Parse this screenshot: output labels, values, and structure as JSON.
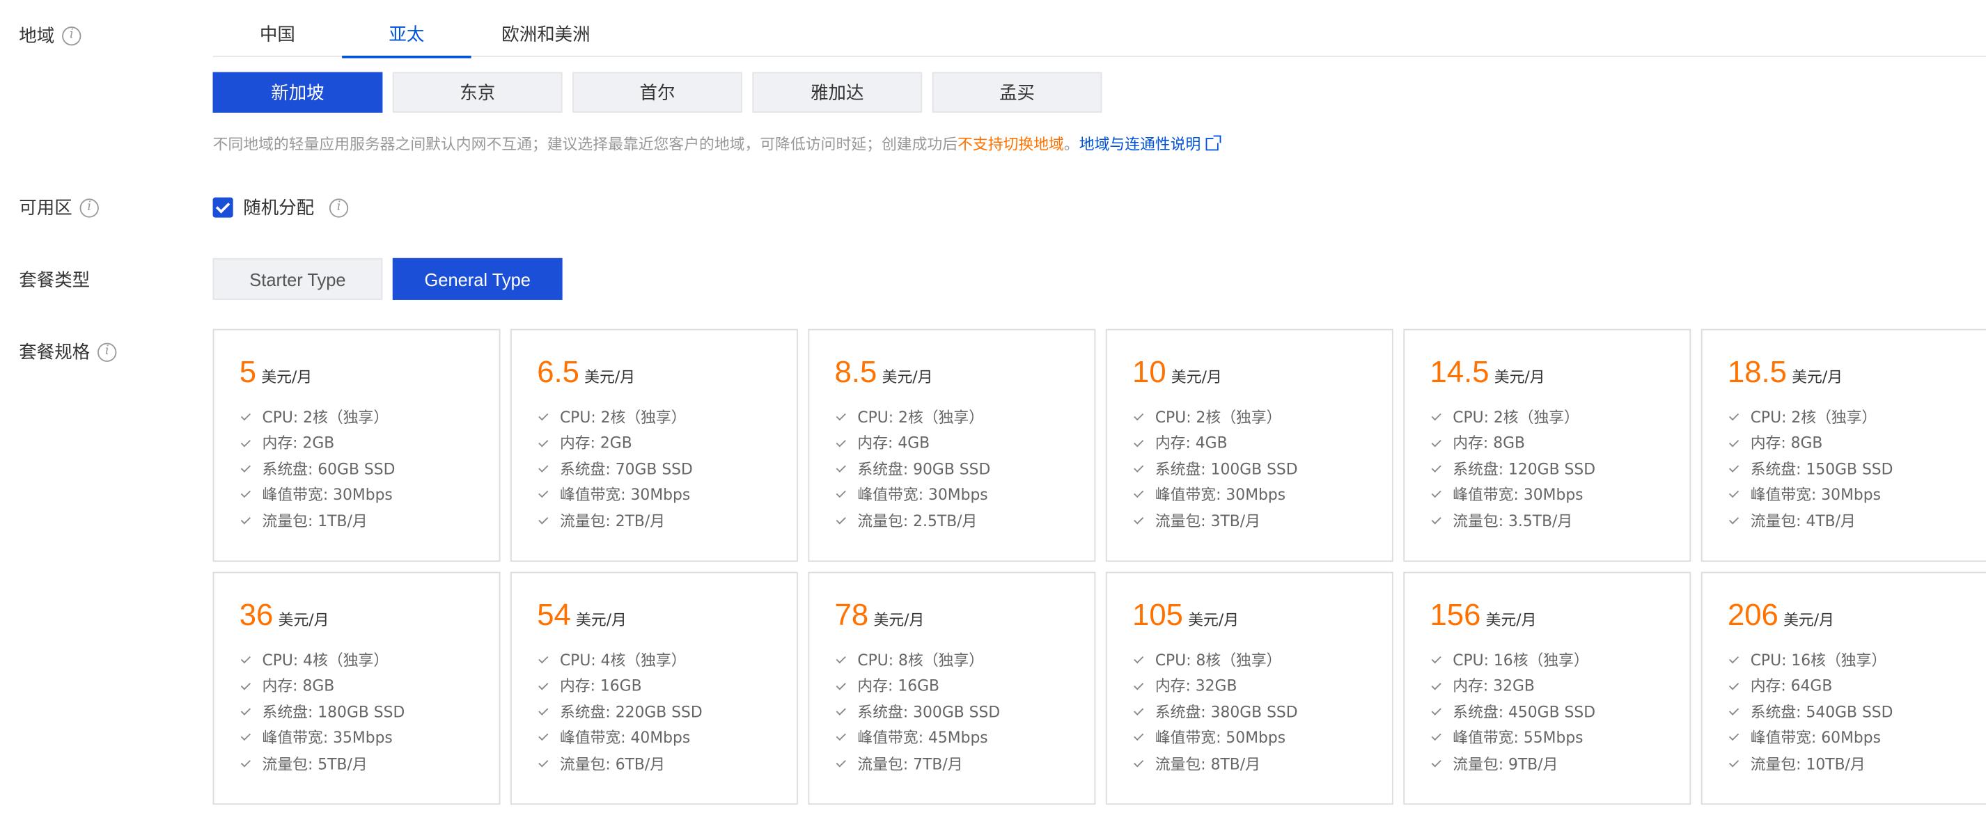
{
  "labels": {
    "region": "地域",
    "zone": "可用区",
    "package_type": "套餐类型",
    "package_spec": "套餐规格"
  },
  "region_tabs": [
    {
      "label": "中国",
      "active": false
    },
    {
      "label": "亚太",
      "active": true
    },
    {
      "label": "欧洲和美洲",
      "active": false
    }
  ],
  "cities": [
    {
      "label": "新加坡",
      "active": true
    },
    {
      "label": "东京",
      "active": false
    },
    {
      "label": "首尔",
      "active": false
    },
    {
      "label": "雅加达",
      "active": false
    },
    {
      "label": "孟买",
      "active": false
    }
  ],
  "notice": {
    "text": "不同地域的轻量应用服务器之间默认内网不互通；建议选择最靠近您客户的地域，可降低访问时延；创建成功后",
    "warning": "不支持切换地域",
    "link": "地域与连通性说明"
  },
  "zone": {
    "checkbox_label": "随机分配",
    "checked": true
  },
  "package_types": [
    {
      "label": "Starter Type",
      "active": false
    },
    {
      "label": "General Type",
      "active": true
    }
  ],
  "plans": [
    [
      {
        "price": "5",
        "unit": "美元/月",
        "specs": [
          "CPU: 2核（独享）",
          "内存: 2GB",
          "系统盘: 60GB SSD",
          "峰值带宽: 30Mbps",
          "流量包: 1TB/月"
        ]
      },
      {
        "price": "6.5",
        "unit": "美元/月",
        "specs": [
          "CPU: 2核（独享）",
          "内存: 2GB",
          "系统盘: 70GB SSD",
          "峰值带宽: 30Mbps",
          "流量包: 2TB/月"
        ]
      },
      {
        "price": "8.5",
        "unit": "美元/月",
        "specs": [
          "CPU: 2核（独享）",
          "内存: 4GB",
          "系统盘: 90GB SSD",
          "峰值带宽: 30Mbps",
          "流量包: 2.5TB/月"
        ]
      },
      {
        "price": "10",
        "unit": "美元/月",
        "specs": [
          "CPU: 2核（独享）",
          "内存: 4GB",
          "系统盘: 100GB SSD",
          "峰值带宽: 30Mbps",
          "流量包: 3TB/月"
        ]
      },
      {
        "price": "14.5",
        "unit": "美元/月",
        "specs": [
          "CPU: 2核（独享）",
          "内存: 8GB",
          "系统盘: 120GB SSD",
          "峰值带宽: 30Mbps",
          "流量包: 3.5TB/月"
        ]
      },
      {
        "price": "18.5",
        "unit": "美元/月",
        "specs": [
          "CPU: 2核（独享）",
          "内存: 8GB",
          "系统盘: 150GB SSD",
          "峰值带宽: 30Mbps",
          "流量包: 4TB/月"
        ]
      }
    ],
    [
      {
        "price": "36",
        "unit": "美元/月",
        "specs": [
          "CPU: 4核（独享）",
          "内存: 8GB",
          "系统盘: 180GB SSD",
          "峰值带宽: 35Mbps",
          "流量包: 5TB/月"
        ]
      },
      {
        "price": "54",
        "unit": "美元/月",
        "specs": [
          "CPU: 4核（独享）",
          "内存: 16GB",
          "系统盘: 220GB SSD",
          "峰值带宽: 40Mbps",
          "流量包: 6TB/月"
        ]
      },
      {
        "price": "78",
        "unit": "美元/月",
        "specs": [
          "CPU: 8核（独享）",
          "内存: 16GB",
          "系统盘: 300GB SSD",
          "峰值带宽: 45Mbps",
          "流量包: 7TB/月"
        ]
      },
      {
        "price": "105",
        "unit": "美元/月",
        "specs": [
          "CPU: 8核（独享）",
          "内存: 32GB",
          "系统盘: 380GB SSD",
          "峰值带宽: 50Mbps",
          "流量包: 8TB/月"
        ]
      },
      {
        "price": "156",
        "unit": "美元/月",
        "specs": [
          "CPU: 16核（独享）",
          "内存: 32GB",
          "系统盘: 450GB SSD",
          "峰值带宽: 55Mbps",
          "流量包: 9TB/月"
        ]
      },
      {
        "price": "206",
        "unit": "美元/月",
        "specs": [
          "CPU: 16核（独享）",
          "内存: 64GB",
          "系统盘: 540GB SSD",
          "峰值带宽: 60Mbps",
          "流量包: 10TB/月"
        ]
      }
    ]
  ],
  "colors": {
    "primary": "#1c4fd8",
    "price": "#ff7200",
    "link": "#0052d9"
  }
}
